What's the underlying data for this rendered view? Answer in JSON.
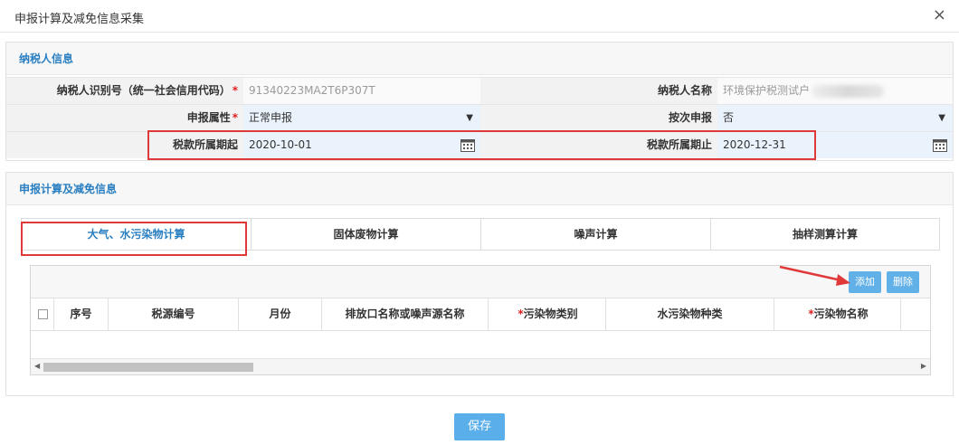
{
  "dialog": {
    "title": "申报计算及减免信息采集",
    "close": "×"
  },
  "taxpayer_section": {
    "title": "纳税人信息",
    "id_label": "纳税人识别号（统一社会信用代码）",
    "id_value": "91340223MA2T6P307T",
    "name_label": "纳税人名称",
    "name_value": "环境保护税测试户",
    "attr_label": "申报属性",
    "attr_value": "正常申报",
    "per_label": "按次申报",
    "per_value": "否",
    "start_label": "税款所属期起",
    "start_value": "2020-10-01",
    "end_label": "税款所属期止",
    "end_value": "2020-12-31"
  },
  "calc_section": {
    "title": "申报计算及减免信息",
    "tabs": [
      "大气、水污染物计算",
      "固体废物计算",
      "噪声计算",
      "抽样测算计算"
    ],
    "add_label": "添加",
    "delete_label": "删除",
    "columns": [
      "序号",
      "税源编号",
      "月份",
      "排放口名称或噪声源名称",
      "污染物类别",
      "水污染物种类",
      "污染物名称"
    ]
  },
  "footer": {
    "save_label": "保存"
  },
  "colors": {
    "accent": "#2a7fc1",
    "button": "#5aaeea",
    "highlight_box": "#e0393a",
    "required": "#e02020"
  }
}
